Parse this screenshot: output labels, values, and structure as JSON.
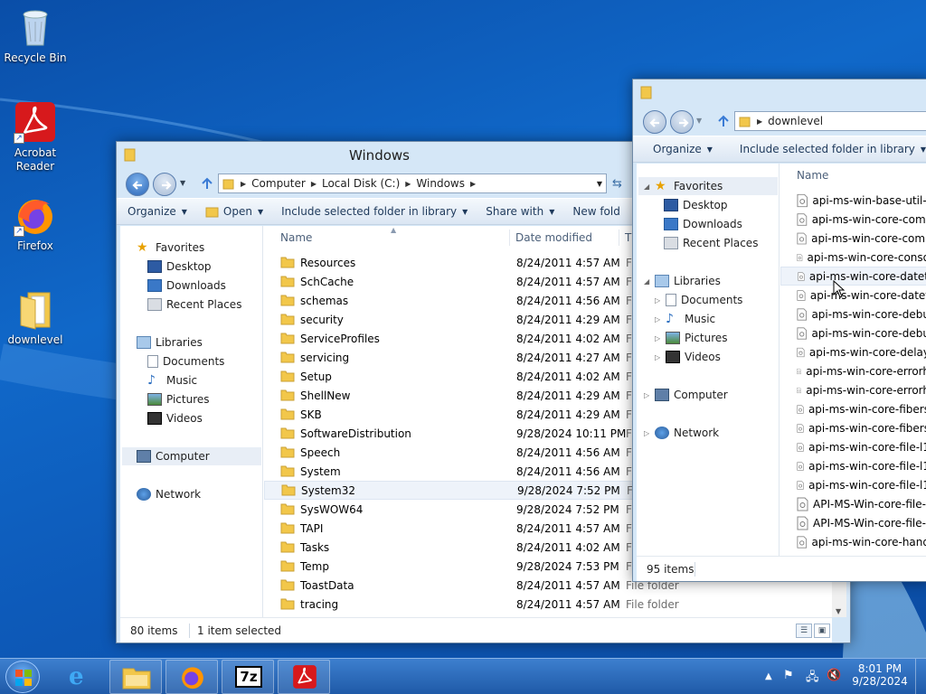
{
  "desktop": {
    "icons": [
      {
        "label": "Recycle Bin",
        "icon": "recycle-bin-icon"
      },
      {
        "label": "Acrobat Reader",
        "icon": "acrobat-reader-icon"
      },
      {
        "label": "Firefox",
        "icon": "firefox-icon"
      },
      {
        "label": "downlevel",
        "icon": "folder-icon"
      }
    ]
  },
  "window_windows": {
    "title": "Windows",
    "breadcrumb": [
      "Computer",
      "Local Disk (C:)",
      "Windows"
    ],
    "toolbar": [
      "Organize",
      "Open",
      "Include selected folder in library",
      "Share with",
      "New fold"
    ],
    "nav": {
      "favorites": "Favorites",
      "fav_items": [
        "Desktop",
        "Downloads",
        "Recent Places"
      ],
      "libraries": "Libraries",
      "lib_items": [
        "Documents",
        "Music",
        "Pictures",
        "Videos"
      ],
      "computer": "Computer",
      "network": "Network"
    },
    "columns": {
      "name": "Name",
      "date": "Date modified",
      "type": "T"
    },
    "rows": [
      {
        "name": "Resources",
        "date": "8/24/2011 4:57 AM",
        "type": "F"
      },
      {
        "name": "SchCache",
        "date": "8/24/2011 4:57 AM",
        "type": "F"
      },
      {
        "name": "schemas",
        "date": "8/24/2011 4:56 AM",
        "type": "F"
      },
      {
        "name": "security",
        "date": "8/24/2011 4:29 AM",
        "type": "F"
      },
      {
        "name": "ServiceProfiles",
        "date": "8/24/2011 4:02 AM",
        "type": "F"
      },
      {
        "name": "servicing",
        "date": "8/24/2011 4:27 AM",
        "type": "F"
      },
      {
        "name": "Setup",
        "date": "8/24/2011 4:02 AM",
        "type": "F"
      },
      {
        "name": "ShellNew",
        "date": "8/24/2011 4:29 AM",
        "type": "F"
      },
      {
        "name": "SKB",
        "date": "8/24/2011 4:29 AM",
        "type": "F"
      },
      {
        "name": "SoftwareDistribution",
        "date": "9/28/2024 10:11 PM",
        "type": "F"
      },
      {
        "name": "Speech",
        "date": "8/24/2011 4:56 AM",
        "type": "F"
      },
      {
        "name": "System",
        "date": "8/24/2011 4:56 AM",
        "type": "F"
      },
      {
        "name": "System32",
        "date": "9/28/2024 7:52 PM",
        "type": "F"
      },
      {
        "name": "SysWOW64",
        "date": "9/28/2024 7:52 PM",
        "type": "F"
      },
      {
        "name": "TAPI",
        "date": "8/24/2011 4:57 AM",
        "type": "F"
      },
      {
        "name": "Tasks",
        "date": "8/24/2011 4:02 AM",
        "type": "F"
      },
      {
        "name": "Temp",
        "date": "9/28/2024 7:53 PM",
        "type": "F"
      },
      {
        "name": "ToastData",
        "date": "8/24/2011 4:57 AM",
        "type": "File folder"
      },
      {
        "name": "tracing",
        "date": "8/24/2011 4:57 AM",
        "type": "File folder"
      }
    ],
    "selected_row": "System32",
    "status_items": "80 items",
    "status_selected": "1 item selected"
  },
  "window_downlevel": {
    "breadcrumb": [
      "downlevel"
    ],
    "toolbar": [
      "Organize",
      "Include selected folder in library"
    ],
    "nav": {
      "favorites": "Favorites",
      "fav_items": [
        "Desktop",
        "Downloads",
        "Recent Places"
      ],
      "libraries": "Libraries",
      "lib_items": [
        "Documents",
        "Music",
        "Pictures",
        "Videos"
      ],
      "computer": "Computer",
      "network": "Network"
    },
    "column_name": "Name",
    "files": [
      "api-ms-win-base-util-l",
      "api-ms-win-core-com-",
      "api-ms-win-core-comr",
      "api-ms-win-core-conso",
      "api-ms-win-core-datet",
      "api-ms-win-core-datet",
      "api-ms-win-core-debu",
      "api-ms-win-core-debu",
      "api-ms-win-core-delay",
      "api-ms-win-core-errorh",
      "api-ms-win-core-errorh",
      "api-ms-win-core-fibers",
      "api-ms-win-core-fibers",
      "api-ms-win-core-file-l1",
      "api-ms-win-core-file-l1",
      "api-ms-win-core-file-l1",
      "API-MS-Win-core-file-l",
      "API-MS-Win-core-file-l",
      "api-ms-win-core-hand"
    ],
    "status_items": "95 items"
  },
  "taskbar": {
    "apps": [
      "internet-explorer-icon",
      "file-explorer-icon",
      "firefox-icon",
      "7zip-icon",
      "acrobat-reader-icon"
    ],
    "sevenzip": "7z",
    "time": "8:01 PM",
    "date": "9/28/2024"
  },
  "colors": {
    "desktop_blue": "#0d5ab9",
    "window_frame": "#d5e7f7",
    "folder_yellow": "#f2c74a",
    "acrobat_red": "#d7191c"
  }
}
